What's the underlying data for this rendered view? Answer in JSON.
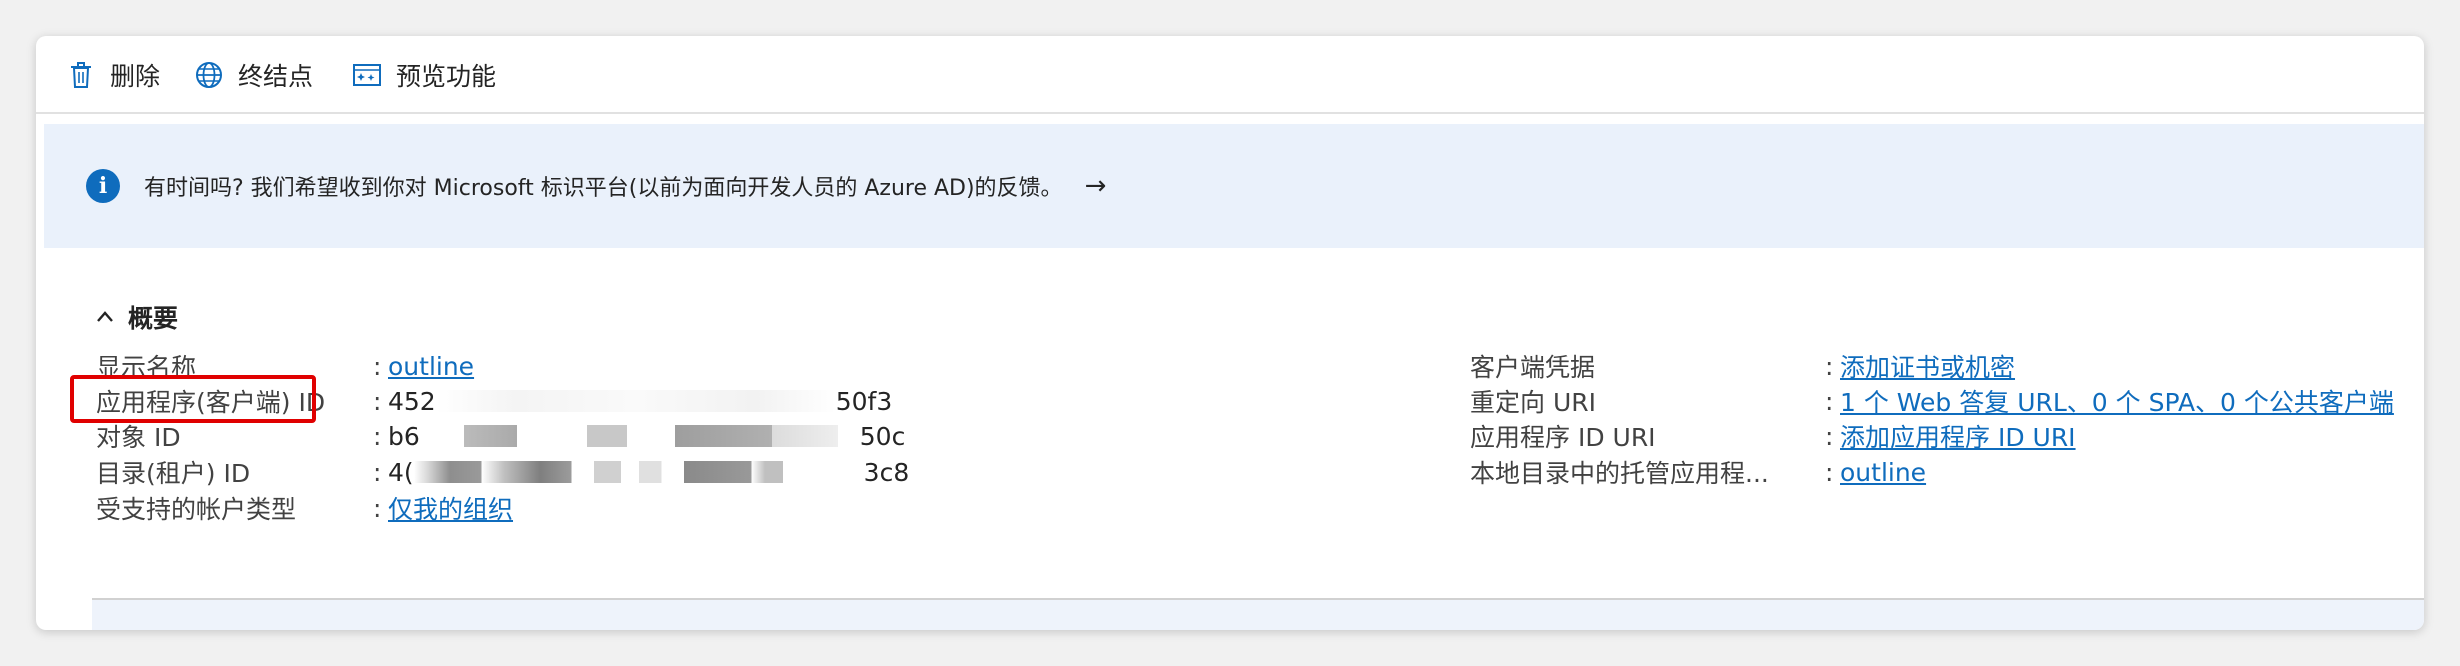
{
  "toolbar": {
    "delete": "删除",
    "endpoints": "终结点",
    "preview": "预览功能"
  },
  "banner": {
    "message": "有时间吗? 我们希望收到你对 Microsoft 标识平台(以前为面向开发人员的 Azure AD)的反馈。",
    "arrow": "→"
  },
  "overview": {
    "title": "概要",
    "colon": ":",
    "left": [
      {
        "label": "显示名称",
        "value": "outline",
        "link": true
      },
      {
        "label": "应用程序(客户端) ID",
        "value_start": "452",
        "value_end": "50f3"
      },
      {
        "label": "对象 ID",
        "value_start": "b6",
        "value_end": "50c"
      },
      {
        "label": "目录(租户) ID",
        "value_start": "4(",
        "value_end": "3c8"
      },
      {
        "label": "受支持的帐户类型",
        "value": "仅我的组织",
        "link": true
      }
    ],
    "right": [
      {
        "label": "客户端凭据",
        "value": "添加证书或机密"
      },
      {
        "label": "重定向 URI",
        "value": "1 个 Web 答复 URL、0 个 SPA、0 个公共客户端"
      },
      {
        "label": "应用程序 ID URI",
        "value": "添加应用程序 ID URI"
      },
      {
        "label": "本地目录中的托管应用程...",
        "value": "outline"
      }
    ]
  },
  "colors": {
    "accent": "#0f6cbd",
    "highlight": "#e00000",
    "banner_bg": "#eaf1fb"
  }
}
